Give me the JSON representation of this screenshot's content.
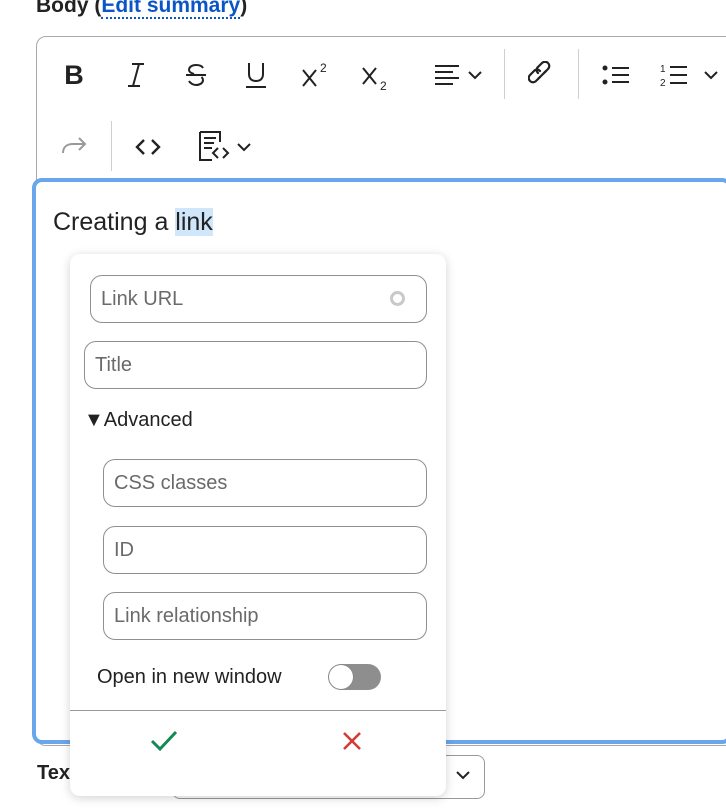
{
  "field": {
    "label": "Body",
    "link_text": "Edit summary"
  },
  "toolbar": {
    "items": [
      {
        "name": "bold",
        "label": "B"
      },
      {
        "name": "italic"
      },
      {
        "name": "strikethrough"
      },
      {
        "name": "underline"
      },
      {
        "name": "superscript"
      },
      {
        "name": "subscript"
      },
      {
        "name": "align"
      },
      {
        "name": "link"
      },
      {
        "name": "bulleted-list"
      },
      {
        "name": "numbered-list"
      },
      {
        "name": "redo"
      },
      {
        "name": "code"
      },
      {
        "name": "source-editing"
      }
    ]
  },
  "content": {
    "text_before": "Creating a ",
    "selected_text": "link"
  },
  "link_form": {
    "url_placeholder": "Link URL",
    "title_placeholder": "Title",
    "advanced_label": "Advanced",
    "css_placeholder": "CSS classes",
    "id_placeholder": "ID",
    "rel_placeholder": "Link relationship",
    "new_window_label": "Open in new window",
    "new_window_on": false
  },
  "bottom": {
    "label_visible": "Tex"
  },
  "colors": {
    "accent": "#6aa6ec",
    "save": "#138a55",
    "cancel": "#d43a35",
    "link": "#0b56c6"
  }
}
